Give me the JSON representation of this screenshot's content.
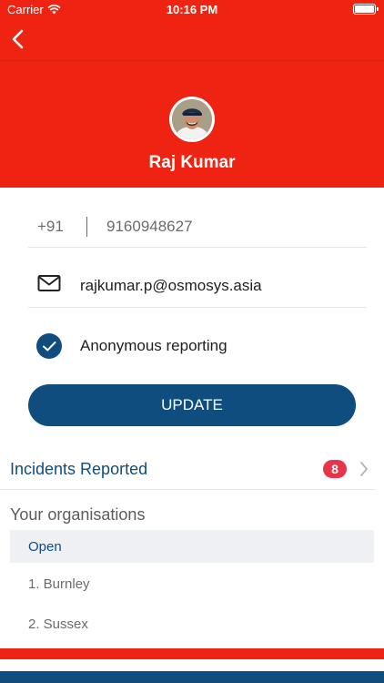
{
  "status_bar": {
    "carrier": "Carrier",
    "time": "10:16 PM",
    "wifi_icon": "wifi-icon",
    "battery_icon": "battery-icon"
  },
  "nav": {
    "back_icon": "chevron-left-icon"
  },
  "profile": {
    "name": "Raj Kumar"
  },
  "form": {
    "country_code": "+91",
    "phone": "9160948627",
    "email": "rajkumar.p@osmosys.asia",
    "anonymous_label": "Anonymous reporting",
    "anonymous_checked": true,
    "update_label": "UPDATE"
  },
  "incidents": {
    "label": "Incidents Reported",
    "count": "8"
  },
  "organisations": {
    "title": "Your organisations",
    "group_label": "Open",
    "items": [
      "1. Burnley",
      "2. Sussex"
    ]
  },
  "colors": {
    "brand_red": "#ee2311",
    "brand_blue": "#0e4d7d",
    "badge_red": "#e8344b"
  }
}
